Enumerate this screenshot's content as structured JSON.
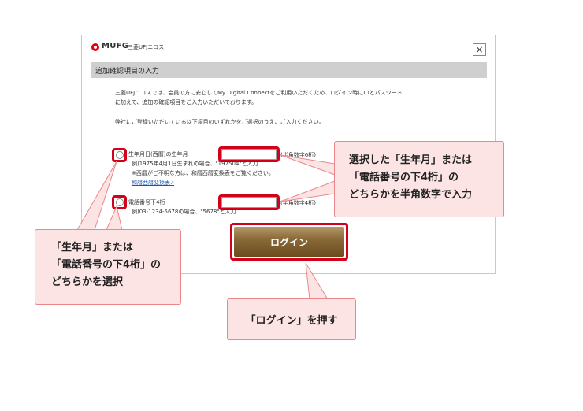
{
  "dialog": {
    "brand": "MUFG",
    "brand_sub": "三菱UFJニコス",
    "close_glyph": "×",
    "section_title": "追加確認項目の入力",
    "intro_line1": "三菱UFJニコスでは、会員の方に安心してMy Digital Connectをご利用いただくため、ログイン時にIDとパスワード",
    "intro_line2": "に加えて、追加の確認項目をご入力いただいております。",
    "intro_line3": "弊社にご登録いただいている以下項目のいずれかをご選択のうえ、ご入力ください。",
    "birth": {
      "label": "生年月日(西暦)の生年月",
      "hint": "半角数字6桁",
      "example": "例)1975年4月1日生まれの場合、\"197504\"と入力",
      "note": "※西暦がご不明な方は、和暦西暦変換表をご覧ください。",
      "link": "和暦西暦変換表"
    },
    "phone": {
      "label": "電話番号下4桁",
      "hint": "半角数字4桁",
      "example": "例)03-1234-5678の場合、\"5678\"と入力"
    },
    "login_label": "ログイン"
  },
  "callouts": {
    "select": [
      "「生年月」または",
      "「電話番号の下4桁」の",
      "どちらかを選択"
    ],
    "input": [
      "選択した「生年月」または",
      "「電話番号の下4桁」の",
      "どちらかを半角数字で入力"
    ],
    "press": "「ログイン」を押す"
  },
  "colors": {
    "highlight": "#d3001a",
    "callout_fill": "#fce4e4",
    "callout_border": "#e9878b",
    "login_button": "#7a5a2a"
  }
}
